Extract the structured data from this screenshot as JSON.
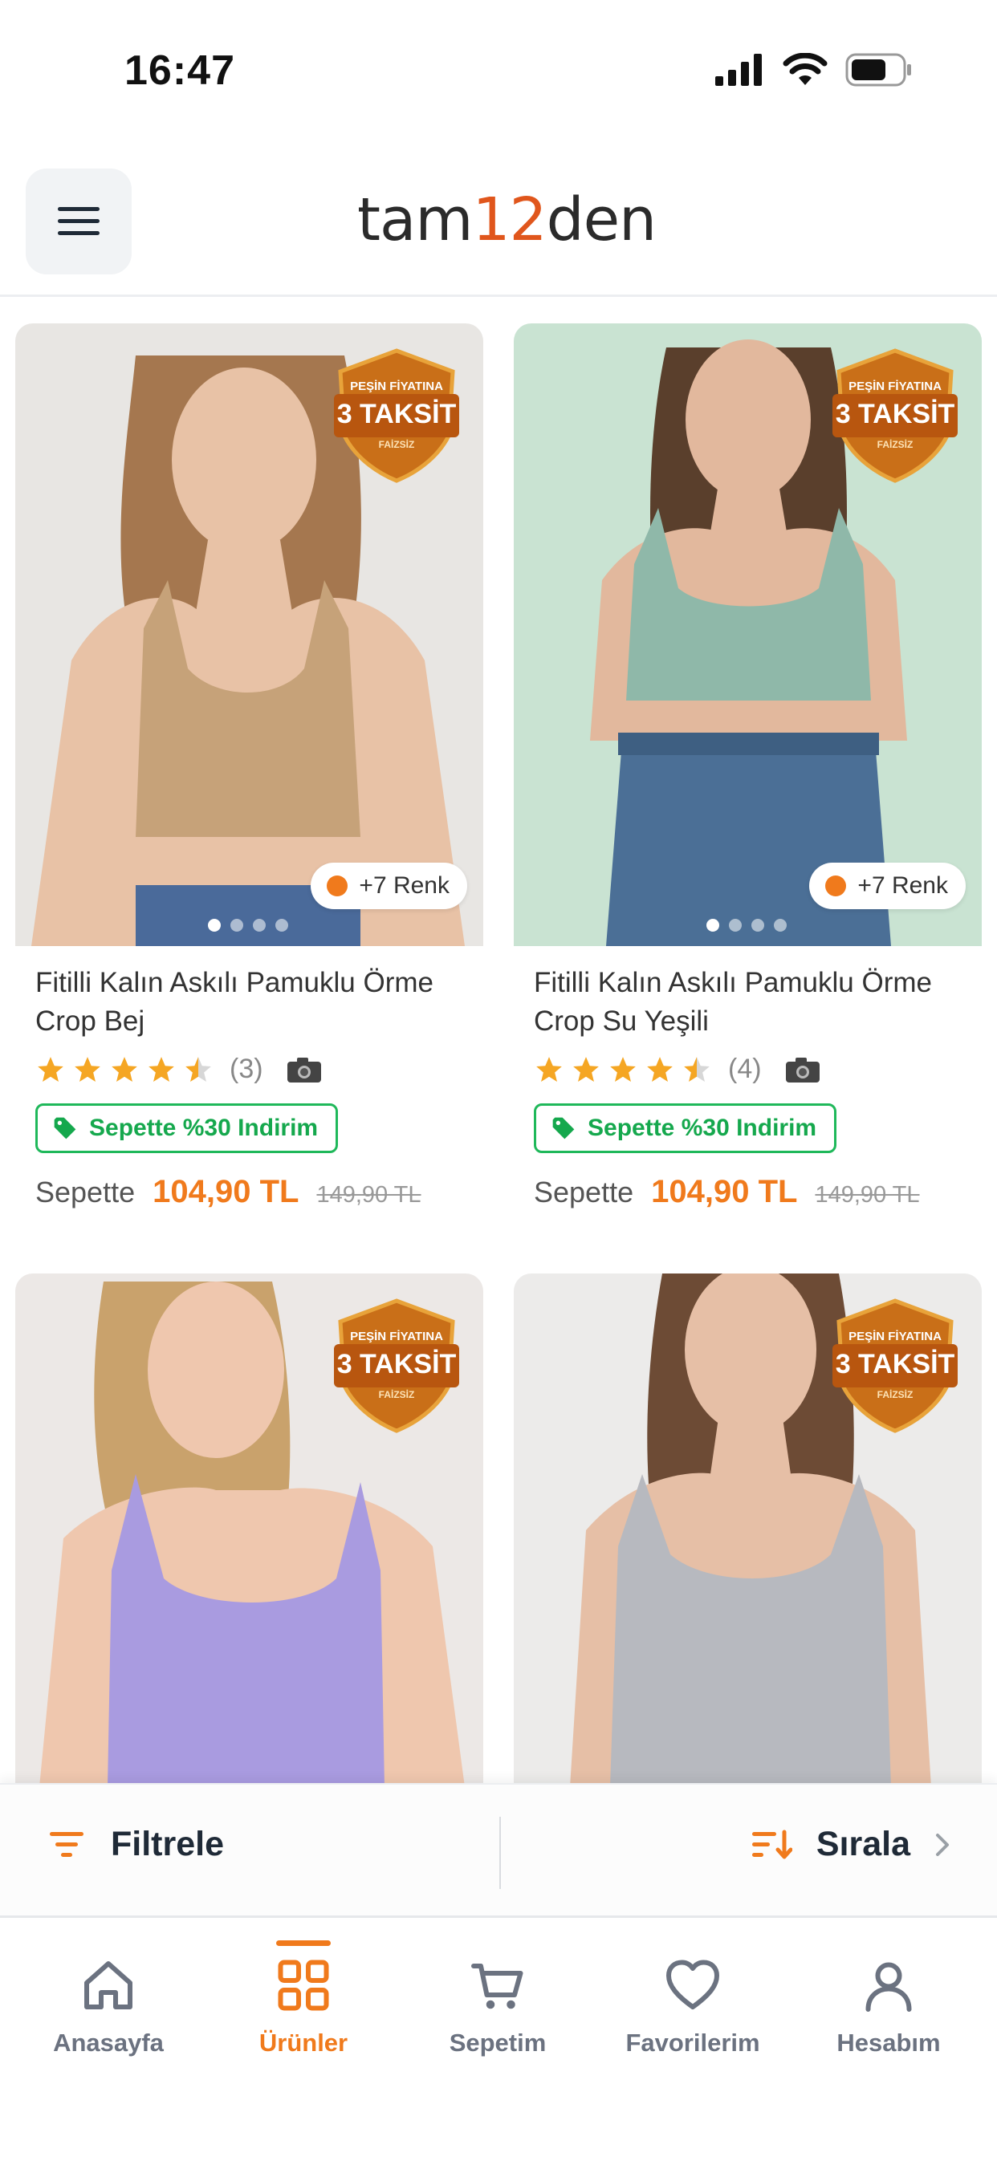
{
  "status_bar": {
    "time": "16:47",
    "icons": [
      "cellular-signal-icon",
      "wifi-icon",
      "battery-icon"
    ]
  },
  "header": {
    "logo_part1": "tam",
    "logo_part2": "12",
    "logo_part3": "den",
    "menu_icon": "hamburger-menu-icon"
  },
  "badge_text": {
    "line1": "PEŞİN FİYATINA",
    "line2": "3 TAKSİT",
    "line3": "FAİZSİZ"
  },
  "products": [
    {
      "title": "Fitilli Kalın Askılı Pamuklu Örme Crop Bej",
      "rating": 4.5,
      "rating_count": "(3)",
      "discount_label": "Sepette %30 Indirim",
      "price_prefix": "Sepette",
      "price_now": "104,90 TL",
      "price_old": "149,90 TL",
      "colors_label": "+7 Renk",
      "image_colors": {
        "bg": "#e8e6e3",
        "top": "#c6a279",
        "skin": "#e8c2a6",
        "hair": "#a5774f"
      },
      "image_index": 1,
      "image_count": 4
    },
    {
      "title": "Fitilli Kalın Askılı Pamuklu Örme Crop Su Yeşili",
      "rating": 4.5,
      "rating_count": "(4)",
      "discount_label": "Sepette %30 Indirim",
      "price_prefix": "Sepette",
      "price_now": "104,90 TL",
      "price_old": "149,90 TL",
      "colors_label": "+7 Renk",
      "image_colors": {
        "bg": "#c9e3d2",
        "top": "#8fb8a9",
        "skin": "#e2b89d",
        "hair": "#5a3f2c"
      },
      "image_index": 1,
      "image_count": 4
    },
    {
      "title": "",
      "image_colors": {
        "bg": "#ece8e6",
        "top": "#a99be0",
        "skin": "#efc7ae",
        "hair": "#c9a26c"
      }
    },
    {
      "title": "",
      "image_colors": {
        "bg": "#ecebea",
        "top": "#b7b9bf",
        "skin": "#e6bfa6",
        "hair": "#6d4b35"
      }
    }
  ],
  "filter_bar": {
    "filter_label": "Filtrele",
    "sort_label": "Sırala"
  },
  "tab_bar": {
    "tabs": [
      {
        "label": "Anasayfa",
        "icon": "home-icon",
        "active": false
      },
      {
        "label": "Ürünler",
        "icon": "grid-icon",
        "active": true
      },
      {
        "label": "Sepetim",
        "icon": "cart-icon",
        "active": false
      },
      {
        "label": "Favorilerim",
        "icon": "heart-icon",
        "active": false
      },
      {
        "label": "Hesabım",
        "icon": "user-icon",
        "active": false
      }
    ]
  },
  "colors": {
    "accent": "#f07a1c",
    "discount_green": "#15a84d",
    "star": "#f5a623"
  }
}
